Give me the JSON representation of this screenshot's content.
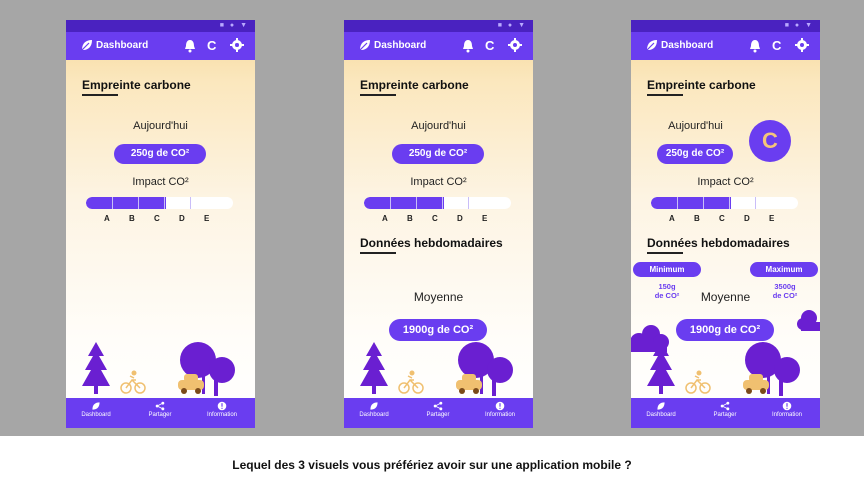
{
  "question": "Lequel des 3 visuels vous préfériez avoir sur une application mobile ?",
  "colors": {
    "primary": "#6a3df0",
    "statusbar": "#4a22c0",
    "grade_text": "#f5c57a",
    "tree": "#6a1fd1",
    "bike": "#f0c070",
    "car": "#f0c070"
  },
  "phones": [
    {
      "appbar": {
        "title": "Dashboard",
        "icons": [
          "leaf-icon",
          "bell-icon",
          "refresh-icon",
          "gear-icon"
        ]
      },
      "heading": "Empreinte carbone",
      "today_label": "Aujourd'hui",
      "today_value": "250g de CO²",
      "impact_label": "Impact CO²",
      "impact_scale": [
        "A",
        "B",
        "C",
        "D",
        "E"
      ],
      "impact_level": "C",
      "nav": [
        {
          "label": "Dashboard",
          "icon": "leaf-icon"
        },
        {
          "label": "Partager",
          "icon": "share-icon"
        },
        {
          "label": "Information",
          "icon": "info-icon"
        }
      ]
    },
    {
      "appbar": {
        "title": "Dashboard",
        "icons": [
          "leaf-icon",
          "bell-icon",
          "refresh-icon",
          "gear-icon"
        ]
      },
      "heading": "Empreinte carbone",
      "today_label": "Aujourd'hui",
      "today_value": "250g de CO²",
      "impact_label": "Impact CO²",
      "impact_scale": [
        "A",
        "B",
        "C",
        "D",
        "E"
      ],
      "impact_level": "C",
      "weekly_heading": "Données hebdomadaires",
      "average_label": "Moyenne",
      "average_value": "1900g de CO²",
      "nav": [
        {
          "label": "Dashboard",
          "icon": "leaf-icon"
        },
        {
          "label": "Partager",
          "icon": "share-icon"
        },
        {
          "label": "Information",
          "icon": "info-icon"
        }
      ]
    },
    {
      "appbar": {
        "title": "Dashboard",
        "icons": [
          "leaf-icon",
          "bell-icon",
          "refresh-icon",
          "gear-icon"
        ]
      },
      "heading": "Empreinte carbone",
      "today_label": "Aujourd'hui",
      "today_value": "250g de CO²",
      "grade": "C",
      "impact_label": "Impact CO²",
      "impact_scale": [
        "A",
        "B",
        "C",
        "D",
        "E"
      ],
      "impact_level": "C",
      "weekly_heading": "Données hebdomadaires",
      "min_label": "Minimum",
      "min_value_1": "150g",
      "min_value_2": "de CO²",
      "max_label": "Maximum",
      "max_value_1": "3500g",
      "max_value_2": "de CO²",
      "average_label": "Moyenne",
      "average_value": "1900g de CO²",
      "nav": [
        {
          "label": "Dashboard",
          "icon": "leaf-icon"
        },
        {
          "label": "Partager",
          "icon": "share-icon"
        },
        {
          "label": "Information",
          "icon": "info-icon"
        }
      ]
    }
  ]
}
